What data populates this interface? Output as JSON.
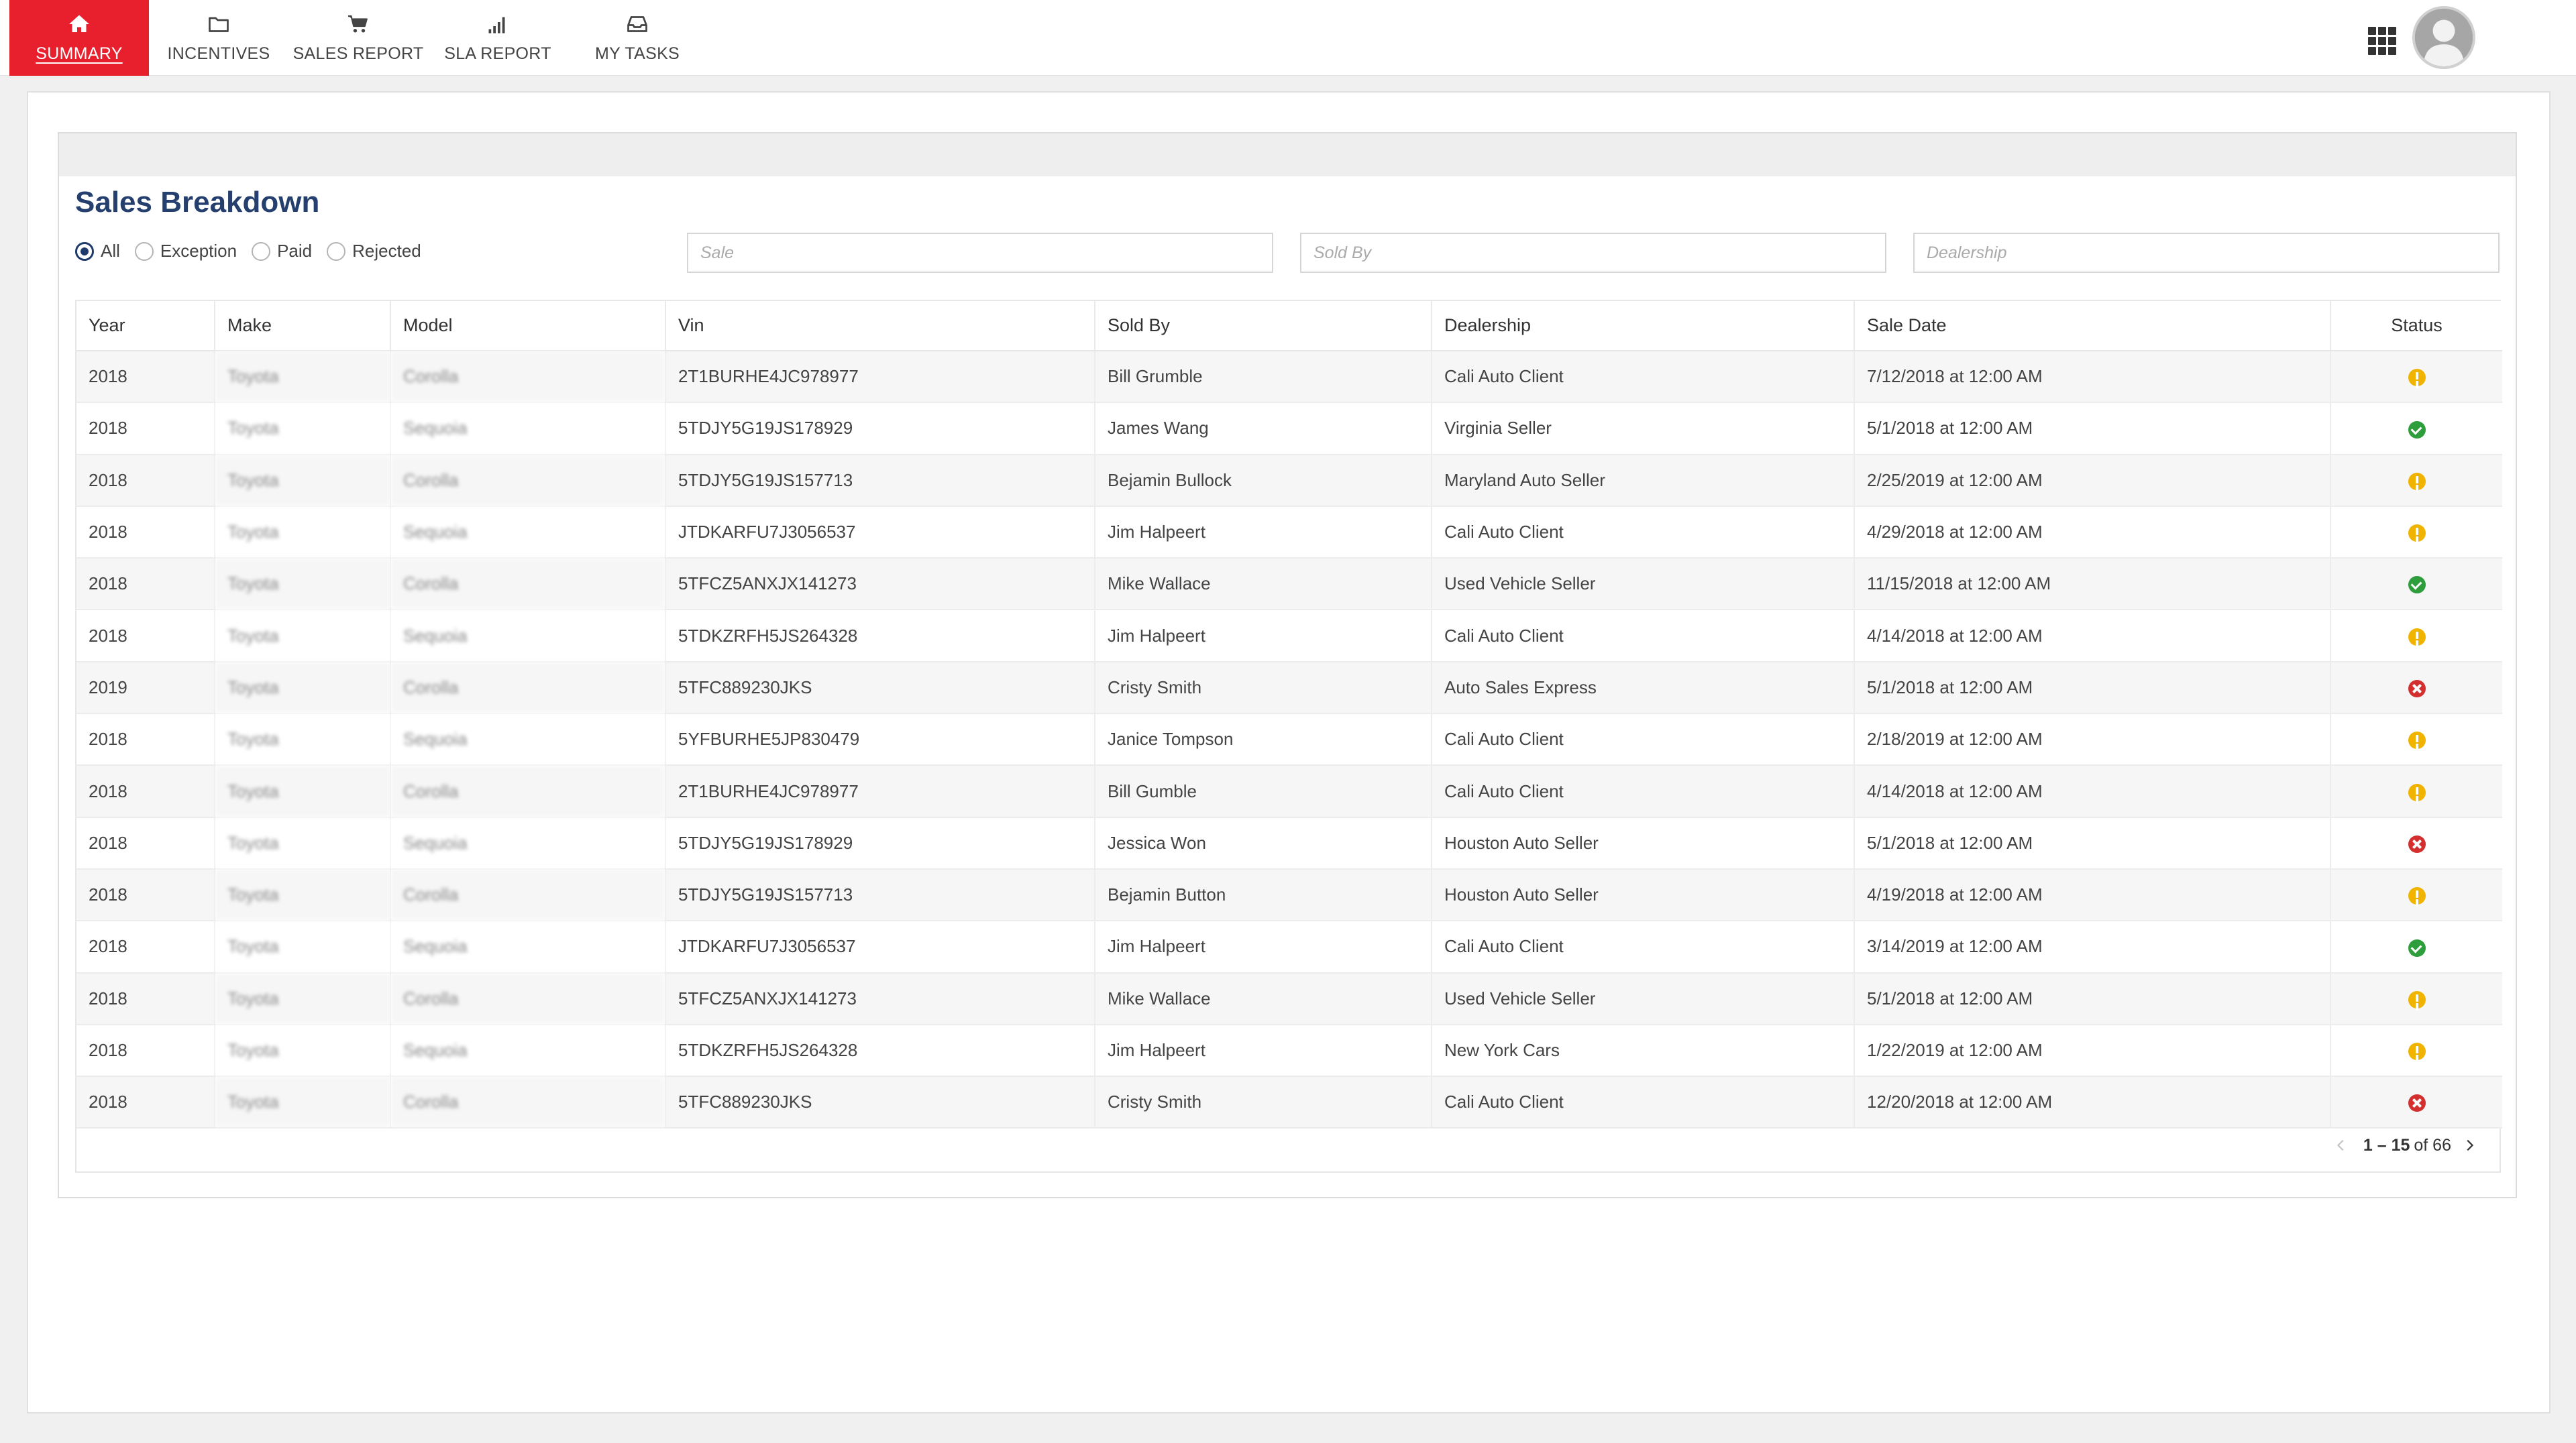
{
  "nav": {
    "items": [
      {
        "label": "SUMMARY",
        "icon": "home-icon",
        "active": true
      },
      {
        "label": "INCENTIVES",
        "icon": "folder-icon",
        "active": false
      },
      {
        "label": "SALES REPORT",
        "icon": "cart-icon",
        "active": false
      },
      {
        "label": "SLA REPORT",
        "icon": "signal-bars-icon",
        "active": false
      },
      {
        "label": "MY TASKS",
        "icon": "inbox-icon",
        "active": false
      }
    ]
  },
  "colors": {
    "accent": "#e8202d",
    "title": "#25406e",
    "pending": "#f0b400",
    "approved": "#2e9d3c",
    "rejected": "#d32f2f"
  },
  "main": {
    "title": "Sales Breakdown",
    "filters": {
      "radios": [
        {
          "label": "All",
          "selected": true
        },
        {
          "label": "Exception",
          "selected": false
        },
        {
          "label": "Paid",
          "selected": false
        },
        {
          "label": "Rejected",
          "selected": false
        }
      ],
      "sale_placeholder": "Sale",
      "sold_by_placeholder": "Sold By",
      "dealership_placeholder": "Dealership"
    },
    "table": {
      "columns": [
        "Year",
        "Make",
        "Model",
        "Vin",
        "Sold By",
        "Dealership",
        "Sale Date",
        "Status"
      ],
      "rows": [
        {
          "year": "2018",
          "make": "Toyota",
          "model": "Corolla",
          "vin": "2T1BURHE4JC978977",
          "sold_by": "Bill Grumble",
          "dealership": "Cali Auto Client",
          "sale_date": "7/12/2018 at 12:00 AM",
          "status": "pending"
        },
        {
          "year": "2018",
          "make": "Toyota",
          "model": "Sequoia",
          "vin": "5TDJY5G19JS178929",
          "sold_by": "James Wang",
          "dealership": "Virginia Seller",
          "sale_date": "5/1/2018 at 12:00 AM",
          "status": "approved"
        },
        {
          "year": "2018",
          "make": "Toyota",
          "model": "Corolla",
          "vin": "5TDJY5G19JS157713",
          "sold_by": "Bejamin Bullock",
          "dealership": "Maryland Auto Seller",
          "sale_date": "2/25/2019 at 12:00 AM",
          "status": "pending"
        },
        {
          "year": "2018",
          "make": "Toyota",
          "model": "Sequoia",
          "vin": "JTDKARFU7J3056537",
          "sold_by": "Jim Halpeert",
          "dealership": "Cali Auto Client",
          "sale_date": "4/29/2018 at 12:00 AM",
          "status": "pending"
        },
        {
          "year": "2018",
          "make": "Toyota",
          "model": "Corolla",
          "vin": "5TFCZ5ANXJX141273",
          "sold_by": "Mike Wallace",
          "dealership": "Used Vehicle Seller",
          "sale_date": "11/15/2018 at 12:00 AM",
          "status": "approved"
        },
        {
          "year": "2018",
          "make": "Toyota",
          "model": "Sequoia",
          "vin": "5TDKZRFH5JS264328",
          "sold_by": "Jim Halpeert",
          "dealership": "Cali Auto Client",
          "sale_date": "4/14/2018 at 12:00 AM",
          "status": "pending"
        },
        {
          "year": "2019",
          "make": "Toyota",
          "model": "Corolla",
          "vin": "5TFC889230JKS",
          "sold_by": "Cristy Smith",
          "dealership": "Auto Sales Express",
          "sale_date": "5/1/2018 at 12:00 AM",
          "status": "rejected"
        },
        {
          "year": "2018",
          "make": "Toyota",
          "model": "Sequoia",
          "vin": "5YFBURHE5JP830479",
          "sold_by": "Janice Tompson",
          "dealership": "Cali Auto Client",
          "sale_date": "2/18/2019 at 12:00 AM",
          "status": "pending"
        },
        {
          "year": "2018",
          "make": "Toyota",
          "model": "Corolla",
          "vin": "2T1BURHE4JC978977",
          "sold_by": "Bill Gumble",
          "dealership": "Cali Auto Client",
          "sale_date": "4/14/2018 at 12:00 AM",
          "status": "pending"
        },
        {
          "year": "2018",
          "make": "Toyota",
          "model": "Sequoia",
          "vin": "5TDJY5G19JS178929",
          "sold_by": "Jessica Won",
          "dealership": "Houston Auto Seller",
          "sale_date": "5/1/2018 at 12:00 AM",
          "status": "rejected"
        },
        {
          "year": "2018",
          "make": "Toyota",
          "model": "Corolla",
          "vin": "5TDJY5G19JS157713",
          "sold_by": "Bejamin Button",
          "dealership": "Houston Auto Seller",
          "sale_date": "4/19/2018 at 12:00 AM",
          "status": "pending"
        },
        {
          "year": "2018",
          "make": "Toyota",
          "model": "Sequoia",
          "vin": "JTDKARFU7J3056537",
          "sold_by": "Jim Halpeert",
          "dealership": "Cali Auto Client",
          "sale_date": "3/14/2019 at 12:00 AM",
          "status": "approved"
        },
        {
          "year": "2018",
          "make": "Toyota",
          "model": "Corolla",
          "vin": "5TFCZ5ANXJX141273",
          "sold_by": "Mike Wallace",
          "dealership": "Used Vehicle Seller",
          "sale_date": "5/1/2018 at 12:00 AM",
          "status": "pending"
        },
        {
          "year": "2018",
          "make": "Toyota",
          "model": "Sequoia",
          "vin": "5TDKZRFH5JS264328",
          "sold_by": "Jim Halpeert",
          "dealership": "New York Cars",
          "sale_date": "1/22/2019 at 12:00 AM",
          "status": "pending"
        },
        {
          "year": "2018",
          "make": "Toyota",
          "model": "Corolla",
          "vin": "5TFC889230JKS",
          "sold_by": "Cristy Smith",
          "dealership": "Cali Auto Client",
          "sale_date": "12/20/2018 at 12:00 AM",
          "status": "rejected"
        }
      ]
    },
    "pagination": {
      "range": "1 – 15",
      "of_label": "of 66"
    }
  }
}
